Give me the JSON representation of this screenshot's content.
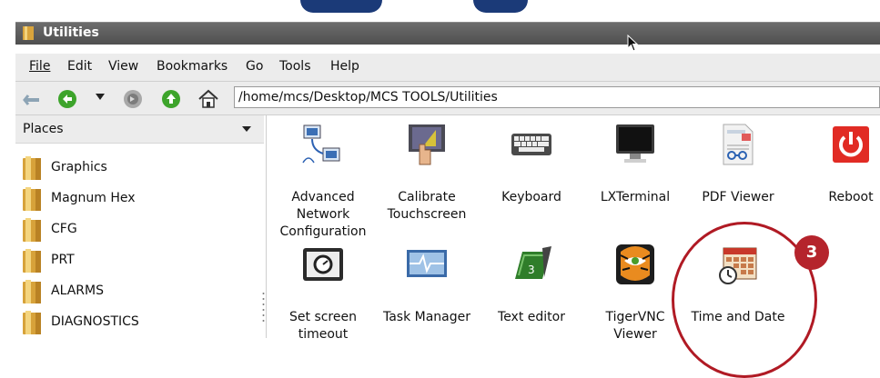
{
  "window": {
    "title": "Utilities"
  },
  "menu": [
    "File",
    "Edit",
    "View",
    "Bookmarks",
    "Go",
    "Tools",
    "Help"
  ],
  "toolbar": {
    "icons": [
      "back-disabled-icon",
      "back-icon",
      "dropdown-arrow-icon",
      "forward-icon",
      "up-icon",
      "home-icon"
    ],
    "path": "/home/mcs/Desktop/MCS TOOLS/Utilities"
  },
  "sidebar": {
    "header": "Places",
    "items": [
      {
        "label": "Graphics"
      },
      {
        "label": "Magnum Hex"
      },
      {
        "label": "CFG"
      },
      {
        "label": "PRT"
      },
      {
        "label": "ALARMS"
      },
      {
        "label": "DIAGNOSTICS"
      }
    ]
  },
  "files": [
    {
      "label": "Advanced\nNetwork\nConfiguration",
      "icon": "network-icon"
    },
    {
      "label": "Calibrate\nTouchscreen",
      "icon": "touchscreen-icon"
    },
    {
      "label": "Keyboard",
      "icon": "keyboard-icon"
    },
    {
      "label": "LXTerminal",
      "icon": "monitor-icon"
    },
    {
      "label": "PDF Viewer",
      "icon": "pdf-icon"
    },
    {
      "label": "Reboot",
      "icon": "power-icon"
    },
    {
      "label": "Set screen\ntimeout",
      "icon": "timer-icon"
    },
    {
      "label": "Task Manager",
      "icon": "task-manager-icon"
    },
    {
      "label": "Text editor",
      "icon": "text-editor-icon"
    },
    {
      "label": "TigerVNC\nViewer",
      "icon": "tiger-icon"
    },
    {
      "label": "Time and Date",
      "icon": "calendar-clock-icon"
    }
  ],
  "callout": {
    "number": "3",
    "color": "#b01a24"
  }
}
